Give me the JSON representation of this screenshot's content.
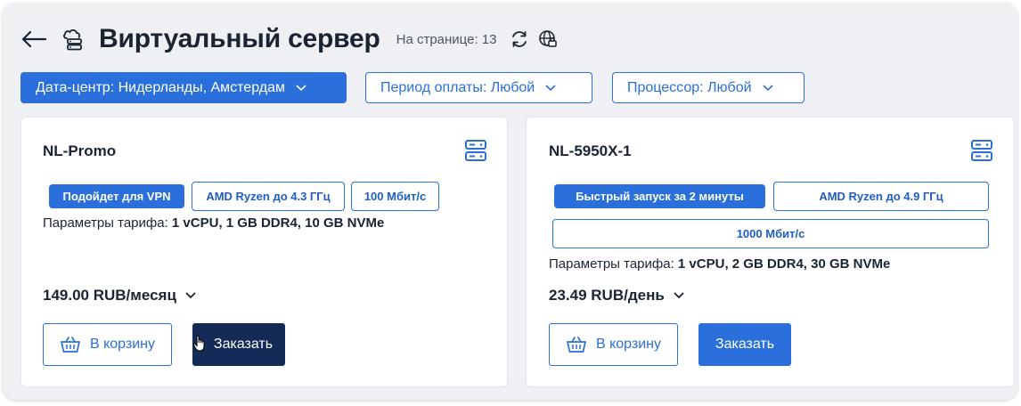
{
  "header": {
    "title": "Виртуальный сервер",
    "per_page": "На странице: 13",
    "back_icon": "arrow-left-icon",
    "section_icon": "cloud-server-icon",
    "refresh_icon": "refresh-icon",
    "globe_icon": "globe-lock-icon"
  },
  "filters": {
    "datacenter": "Дата-центр: Нидерланды, Амстердам",
    "period": "Период оплаты: Любой",
    "cpu": "Процессор: Любой"
  },
  "colors": {
    "accent": "#2a6fdb",
    "order_hover": "#142a57",
    "background": "#eef0f4"
  },
  "cards": [
    {
      "name": "NL-Promo",
      "tags": [
        "Подойдет для VPN",
        "AMD Ryzen до 4.3 ГГц",
        "100 Мбит/с"
      ],
      "params_label": "Параметры тарифа:",
      "params_value": "1 vCPU, 1 GB DDR4, 10 GB NVMe",
      "price": "149.00 RUB/месяц",
      "cart_label": "В корзину",
      "order_label": "Заказать"
    },
    {
      "name": "NL-5950X-1",
      "tags": [
        "Быстрый запуск за 2 минуты",
        "AMD Ryzen до 4.9 ГГц",
        "1000 Мбит/с"
      ],
      "params_label": "Параметры тарифа:",
      "params_value": "1 vCPU, 2 GB DDR4, 30 GB NVMe",
      "price": "23.49 RUB/день",
      "cart_label": "В корзину",
      "order_label": "Заказать"
    }
  ]
}
